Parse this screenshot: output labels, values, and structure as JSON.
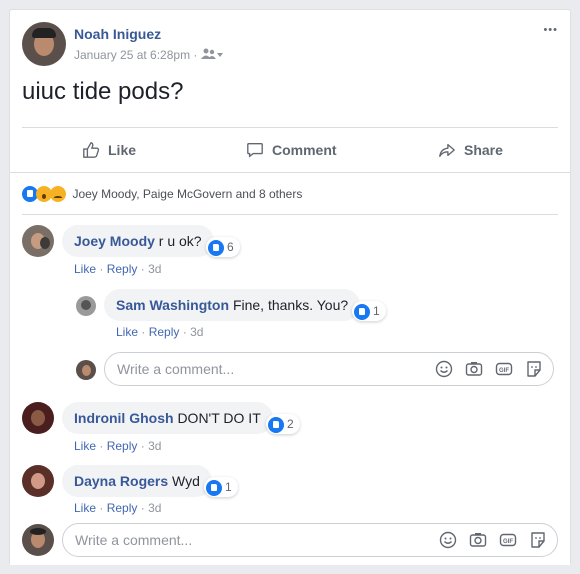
{
  "post": {
    "author": "Noah Iniguez",
    "date": "January 25 at 6:28pm",
    "separator": "·",
    "text": "uiuc tide pods?",
    "more": "•••"
  },
  "actions": {
    "like": "Like",
    "comment": "Comment",
    "share": "Share"
  },
  "reactions_summary": "Joey Moody, Paige McGovern and 8 others",
  "comments": [
    {
      "author": "Joey Moody",
      "text": "r u ok?",
      "reactions": "6",
      "like": "Like",
      "reply": "Reply",
      "time": "3d"
    },
    {
      "author": "Sam Washington",
      "text": "Fine, thanks. You?",
      "reactions": "1",
      "like": "Like",
      "reply": "Reply",
      "time": "3d"
    },
    {
      "author": "Indronil Ghosh",
      "text": "DON'T DO IT",
      "reactions": "2",
      "like": "Like",
      "reply": "Reply",
      "time": "3d"
    },
    {
      "author": "Dayna Rogers",
      "text": "Wyd",
      "reactions": "1",
      "like": "Like",
      "reply": "Reply",
      "time": "3d"
    }
  ],
  "reply_input_placeholder": "Write a comment...",
  "comment_input_placeholder": "Write a comment...",
  "meta_dot": "·",
  "colors": {
    "link": "#385898",
    "accent": "#1877f2",
    "muted": "#90949c",
    "background": "#e9ebee"
  }
}
